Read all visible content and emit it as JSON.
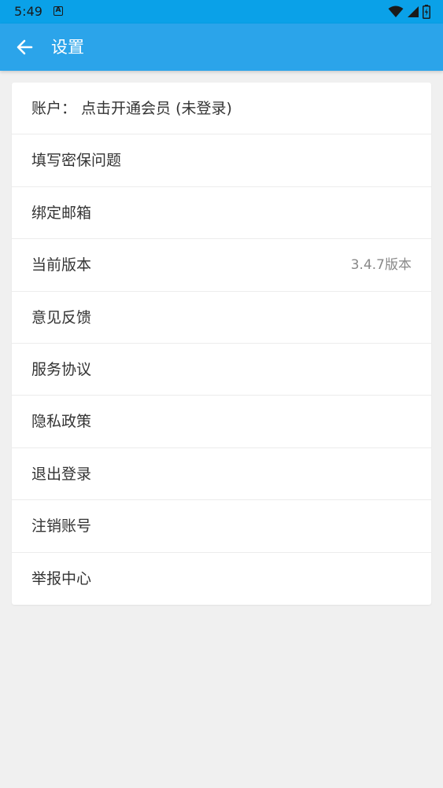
{
  "status_bar": {
    "time": "5:49",
    "notification_icon_letter": "A",
    "icons": [
      "wifi-icon",
      "signal-icon",
      "battery-icon"
    ]
  },
  "app_bar": {
    "title": "设置",
    "back_icon": "arrow-left-icon"
  },
  "settings": {
    "items": [
      {
        "label": "账户：  点击开通会员 (未登录)",
        "value": ""
      },
      {
        "label": "填写密保问题",
        "value": ""
      },
      {
        "label": "绑定邮箱",
        "value": ""
      },
      {
        "label": "当前版本",
        "value": "3.4.7版本"
      },
      {
        "label": "意见反馈",
        "value": ""
      },
      {
        "label": "服务协议",
        "value": ""
      },
      {
        "label": "隐私政策",
        "value": ""
      },
      {
        "label": "退出登录",
        "value": ""
      },
      {
        "label": "注销账号",
        "value": ""
      },
      {
        "label": "举报中心",
        "value": ""
      }
    ]
  },
  "colors": {
    "status_bar": "#0aa1e8",
    "app_bar": "#2ba4ea",
    "background": "#f0f0f0",
    "card": "#ffffff",
    "text_primary": "#333333",
    "text_secondary": "#888888"
  }
}
